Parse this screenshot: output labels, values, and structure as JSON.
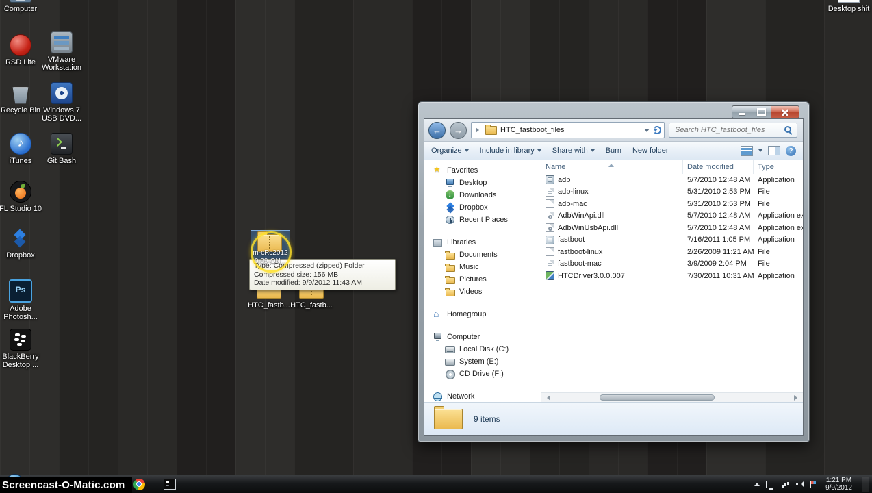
{
  "colors": {
    "selection_blue": "#4691dc",
    "highlight_ring": "#ffe128",
    "taskbar_black": "#0b0c0d"
  },
  "icons": {
    "back-icon": "left-arrow",
    "forward-icon": "right-arrow",
    "refresh-icon": "circular-arrow",
    "search-icon": "magnifier",
    "views-icon": "grid",
    "preview-pane-icon": "split-rect",
    "help-icon": "question-circle",
    "sort-ascending-icon": "up-triangle",
    "start-orb-icon": "windows-orb"
  },
  "desktop": {
    "icons": [
      {
        "label": "Computer",
        "icon": "computer"
      },
      {
        "label": "RSD Lite",
        "icon": "rsd"
      },
      {
        "label": "VMware Workstation",
        "icon": "vmware"
      },
      {
        "label": "Recycle Bin",
        "icon": "recycle"
      },
      {
        "label": "Windows 7 USB DVD...",
        "icon": "windvd"
      },
      {
        "label": "iTunes",
        "icon": "itunes"
      },
      {
        "label": "Git Bash",
        "icon": "git"
      },
      {
        "label": "FL Studio 10",
        "icon": "fl"
      },
      {
        "label": "Dropbox",
        "icon": "dropbox"
      },
      {
        "label": "Adobe Photosh...",
        "icon": "ps"
      },
      {
        "label": "BlackBerry Desktop ...",
        "icon": "bb"
      },
      {
        "label": "Desktop shit",
        "icon": "page"
      }
    ],
    "selected_zip": {
      "label_line1": "m-cRc2012",
      "label_line2": "0.09-ON..."
    },
    "middle_icons": [
      {
        "label": "HTC_fastb..."
      },
      {
        "label": "HTC_fastb..."
      }
    ],
    "tooltip": {
      "type_line": "Type: Compressed (zipped) Folder",
      "size_line": "Compressed size: 156 MB",
      "modified_line": "Date modified: 9/9/2012 11:43 AM"
    }
  },
  "explorer": {
    "nav": {
      "address": "HTC_fastboot_files",
      "search_placeholder": "Search HTC_fastboot_files"
    },
    "toolbar": {
      "organize": "Organize",
      "include": "Include in library",
      "share": "Share with",
      "burn": "Burn",
      "new_folder": "New folder"
    },
    "columns": [
      "Name",
      "Date modified",
      "Type"
    ],
    "sidebar": [
      {
        "label": "Favorites",
        "icon": "star"
      },
      {
        "label": "Desktop",
        "icon": "desktop"
      },
      {
        "label": "Downloads",
        "icon": "downloads"
      },
      {
        "label": "Dropbox",
        "icon": "dropbox"
      },
      {
        "label": "Recent Places",
        "icon": "recent"
      },
      {
        "label": "Libraries",
        "icon": "libraries"
      },
      {
        "label": "Documents",
        "icon": "libfolder"
      },
      {
        "label": "Music",
        "icon": "libfolder"
      },
      {
        "label": "Pictures",
        "icon": "libfolder"
      },
      {
        "label": "Videos",
        "icon": "libfolder"
      },
      {
        "label": "Homegroup",
        "icon": "homegroup"
      },
      {
        "label": "Computer",
        "icon": "pc"
      },
      {
        "label": "Local Disk (C:)",
        "icon": "disk"
      },
      {
        "label": "System (E:)",
        "icon": "disk"
      },
      {
        "label": "CD Drive (F:)",
        "icon": "cd"
      },
      {
        "label": "Network",
        "icon": "network"
      }
    ],
    "files": [
      {
        "name": "adb",
        "date": "5/7/2010 12:48 AM",
        "type": "Application",
        "icon": "app"
      },
      {
        "name": "adb-linux",
        "date": "5/31/2010 2:53 PM",
        "type": "File",
        "icon": "file"
      },
      {
        "name": "adb-mac",
        "date": "5/31/2010 2:53 PM",
        "type": "File",
        "icon": "file"
      },
      {
        "name": "AdbWinApi.dll",
        "date": "5/7/2010 12:48 AM",
        "type": "Application exten...",
        "icon": "dll"
      },
      {
        "name": "AdbWinUsbApi.dll",
        "date": "5/7/2010 12:48 AM",
        "type": "Application exten...",
        "icon": "dll"
      },
      {
        "name": "fastboot",
        "date": "7/16/2011 1:05 PM",
        "type": "Application",
        "icon": "app"
      },
      {
        "name": "fastboot-linux",
        "date": "2/26/2009 11:21 AM",
        "type": "File",
        "icon": "file"
      },
      {
        "name": "fastboot-mac",
        "date": "3/9/2009 2:04 PM",
        "type": "File",
        "icon": "file"
      },
      {
        "name": "HTCDriver3.0.0.007",
        "date": "7/30/2011 10:31 AM",
        "type": "Application",
        "icon": "installer"
      }
    ],
    "status": "9 items"
  },
  "taskbar": {
    "watermark": "Screencast-O-Matic.com",
    "clock_time": "1:21 PM",
    "clock_date": "9/9/2012"
  }
}
